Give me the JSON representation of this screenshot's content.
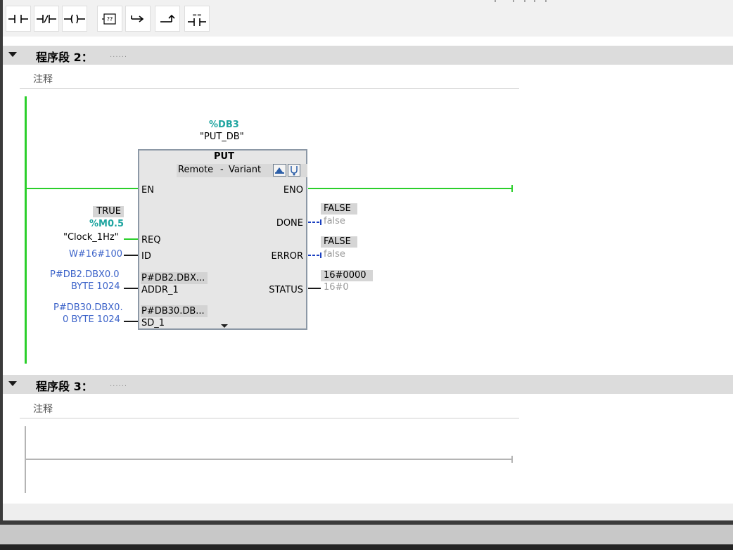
{
  "toolbar": {
    "items": [
      {
        "icon": "no-contact-icon"
      },
      {
        "icon": "nc-contact-icon"
      },
      {
        "icon": "coil-icon"
      },
      {
        "icon": "empty-box-icon",
        "label": "??"
      },
      {
        "icon": "open-branch-icon"
      },
      {
        "icon": "close-branch-icon"
      },
      {
        "icon": "compare-contact-icon"
      }
    ]
  },
  "networks": [
    {
      "title": "程序段 2：",
      "dots": "......",
      "comment": "注释"
    },
    {
      "title": "程序段 3：",
      "dots": "......",
      "comment": "注释"
    }
  ],
  "block": {
    "instance_address": "%DB3",
    "instance_name": "\"PUT_DB\"",
    "type": "PUT",
    "param1": "Remote",
    "sep": "-",
    "param2": "Variant",
    "pins": {
      "en": "EN",
      "eno": "ENO",
      "req": "REQ",
      "id": "ID",
      "addr": "ADDR_1",
      "sd": "SD_1",
      "done": "DONE",
      "error": "ERROR",
      "status": "STATUS"
    },
    "addr_inner": "P#DB2.DBX...",
    "sd_inner": "P#DB30.DB..."
  },
  "inputs": {
    "req_value": "TRUE",
    "req_address": "%M0.5",
    "req_tag": "\"Clock_1Hz\"",
    "id_value": "W#16#100",
    "addr_line1": "P#DB2.DBX0.0",
    "addr_line2": "BYTE 1024",
    "sd_line1": "P#DB30.DBX0.",
    "sd_line2": "0 BYTE 1024"
  },
  "outputs": {
    "done_value": "FALSE",
    "done_tag": "false",
    "error_value": "FALSE",
    "error_tag": "false",
    "status_value": "16#0000",
    "status_tag": "16#0"
  },
  "colors": {
    "power_rail": "#2bcf2b",
    "address_teal": "#1fa5a0",
    "constant_blue": "#3c63c9",
    "header_bg": "#dcdcdc",
    "block_bg": "#e6e6e6"
  }
}
